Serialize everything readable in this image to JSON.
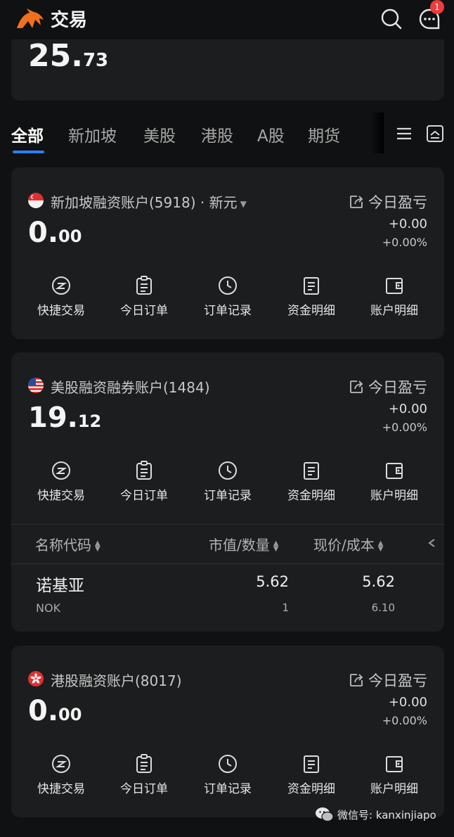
{
  "header": {
    "title": "交易",
    "notification_count": "1"
  },
  "summary": {
    "value_int": "25.",
    "value_dec": "73"
  },
  "tabs": [
    {
      "label": "全部",
      "active": true
    },
    {
      "label": "新加坡",
      "active": false
    },
    {
      "label": "美股",
      "active": false
    },
    {
      "label": "港股",
      "active": false
    },
    {
      "label": "A股",
      "active": false
    },
    {
      "label": "期货",
      "active": false
    }
  ],
  "action_labels": [
    "快捷交易",
    "今日订单",
    "订单记录",
    "资金明细",
    "账户明细"
  ],
  "accounts": [
    {
      "name": "新加坡融资账户(5918) · 新元",
      "flag": "sg-flag-icon",
      "pnl_label": "今日盈亏",
      "value_int": "0.",
      "value_dec": "00",
      "pnl_amount": "+0.00",
      "pnl_percent": "+0.00%"
    },
    {
      "name": "美股融资融券账户(1484)",
      "flag": "us-flag-icon",
      "pnl_label": "今日盈亏",
      "value_int": "19.",
      "value_dec": "12",
      "pnl_amount": "+0.00",
      "pnl_percent": "+0.00%",
      "holdings": {
        "columns": [
          "名称代码",
          "市值/数量",
          "现价/成本"
        ],
        "rows": [
          {
            "name": "诺基亚",
            "code": "NOK",
            "market_value": "5.62",
            "quantity": "1",
            "price": "5.62",
            "cost": "6.10"
          }
        ]
      }
    },
    {
      "name": "港股融资账户(8017)",
      "flag": "hk-flag-icon",
      "pnl_label": "今日盈亏",
      "value_int": "0.",
      "value_dec": "00",
      "pnl_amount": "+0.00",
      "pnl_percent": "+0.00%"
    }
  ],
  "watermark": {
    "text": "微信号: kanxinjiapo"
  },
  "colors": {
    "background": "#101112",
    "card": "#1c1d1e",
    "accent": "#2f7cf6",
    "logo": "#f0701e",
    "badge": "#ee3b3b"
  }
}
